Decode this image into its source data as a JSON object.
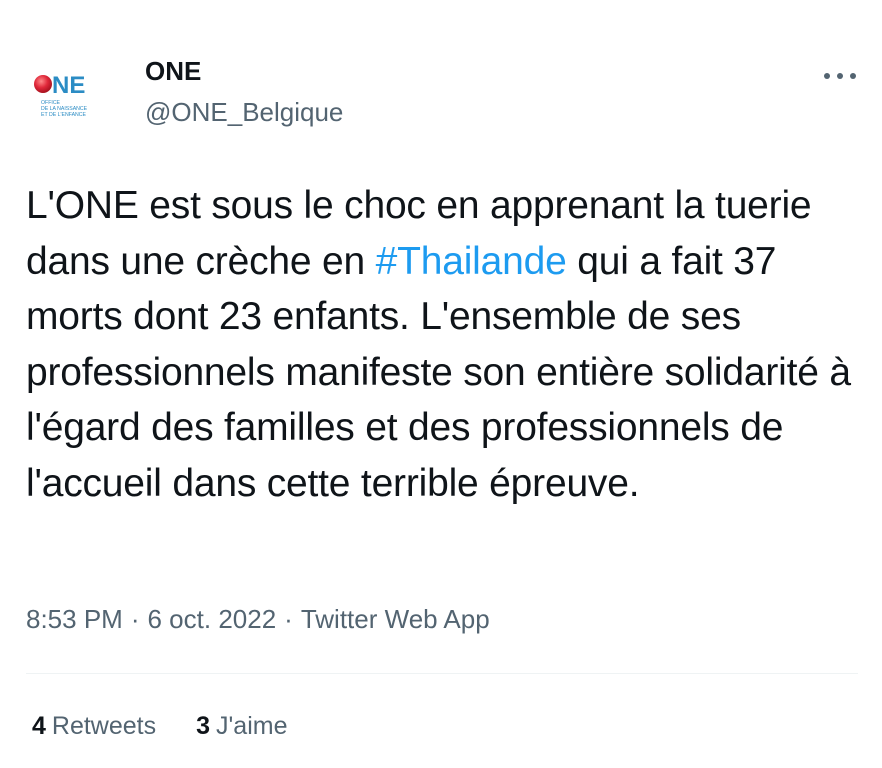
{
  "author": {
    "name": "ONE",
    "handle": "@ONE_Belgique",
    "avatar_logo_text": "ONE",
    "avatar_logo_subtext": [
      "OFFICE",
      "DE LA NAISSANCE",
      "ET DE L'ENFANCE"
    ]
  },
  "tweet": {
    "text_before_hashtag": "L'ONE est sous le choc en apprenant la tuerie dans une crèche en ",
    "hashtag": "#Thailande",
    "text_after_hashtag": " qui a fait 37 morts dont 23 enfants. L'ensemble de ses professionnels manifeste son entière solidarité à l'égard des familles et des professionnels de l'accueil dans cette terrible épreuve."
  },
  "meta": {
    "time": "8:53 PM",
    "separator": "·",
    "date": "6 oct. 2022",
    "source": "Twitter Web App"
  },
  "stats": {
    "retweets_count": "4",
    "retweets_label": "Retweets",
    "likes_count": "3",
    "likes_label": "J'aime"
  },
  "icons": {
    "more": "more-horizontal-icon"
  },
  "colors": {
    "link": "#1d9bf0",
    "secondary_text": "#536471",
    "primary_text": "#0f1419",
    "logo_red": "#e0283a",
    "logo_blue": "#2b8cc4"
  }
}
